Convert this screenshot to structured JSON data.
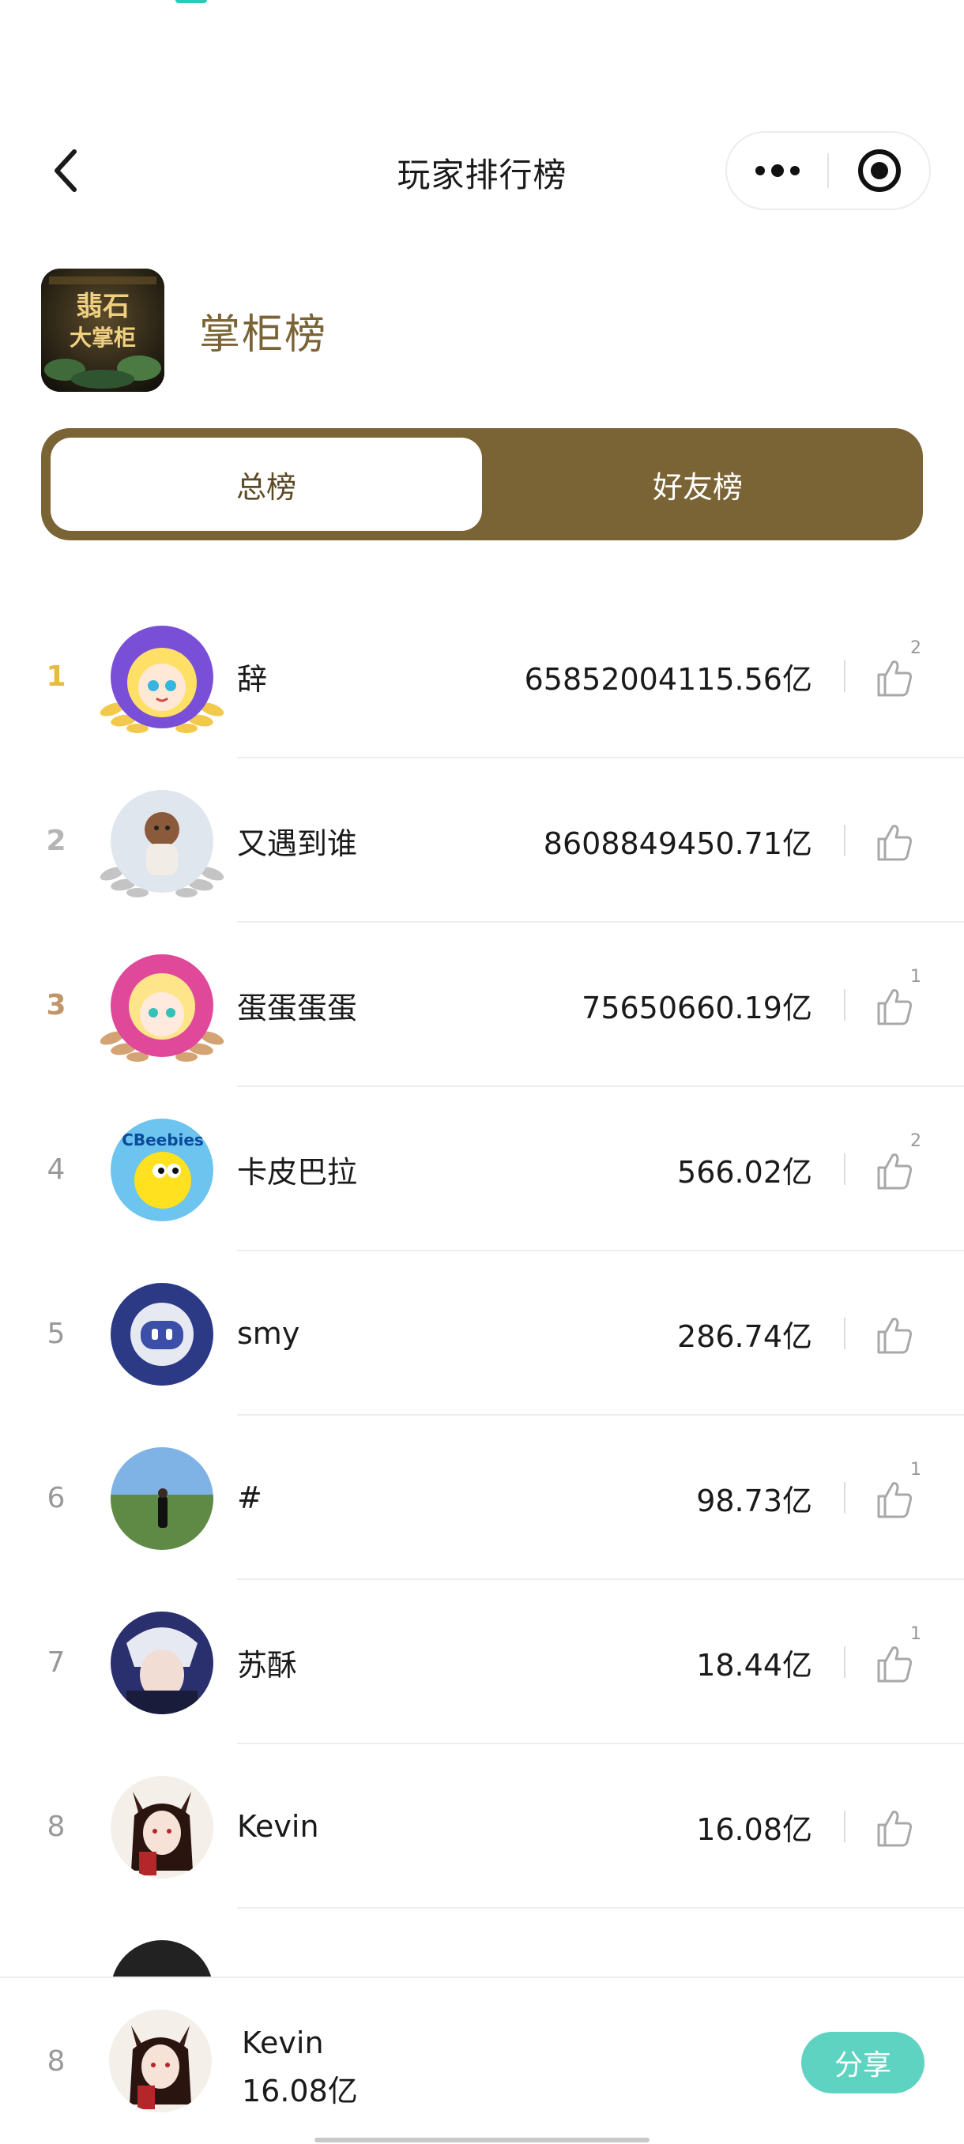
{
  "navbar": {
    "title": "玩家排行榜",
    "back_icon": "chevron-left-icon",
    "more_icon": "more-dots-icon",
    "close_icon": "record-target-icon"
  },
  "game": {
    "logo_text_line1": "翡石",
    "logo_text_line2": "大掌柜",
    "title": "掌柜榜"
  },
  "tabs": [
    {
      "label": "总榜",
      "active": true
    },
    {
      "label": "好友榜",
      "active": false
    }
  ],
  "leaderboard": [
    {
      "rank": "1",
      "name": "辞",
      "score": "65852004115.56亿",
      "likes": "2"
    },
    {
      "rank": "2",
      "name": "又遇到谁",
      "score": "8608849450.71亿",
      "likes": ""
    },
    {
      "rank": "3",
      "name": "蛋蛋蛋蛋",
      "score": "75650660.19亿",
      "likes": "1"
    },
    {
      "rank": "4",
      "name": "卡皮巴拉",
      "score": "566.02亿",
      "likes": "2"
    },
    {
      "rank": "5",
      "name": "smy",
      "score": "286.74亿",
      "likes": ""
    },
    {
      "rank": "6",
      "name": "#",
      "score": "98.73亿",
      "likes": "1"
    },
    {
      "rank": "7",
      "name": "苏酥",
      "score": "18.44亿",
      "likes": "1"
    },
    {
      "rank": "8",
      "name": "Kevin",
      "score": "16.08亿",
      "likes": ""
    }
  ],
  "avatar_logo_text": "CBeebies",
  "me": {
    "rank": "8",
    "name": "Kevin",
    "score": "16.08亿",
    "share_label": "分享"
  },
  "colors": {
    "brand_gold": "#7a6436",
    "share_teal": "#5fd3c1",
    "rank1": "#e7bb3d",
    "rank2": "#b5b5b5",
    "rank3": "#c29569"
  }
}
